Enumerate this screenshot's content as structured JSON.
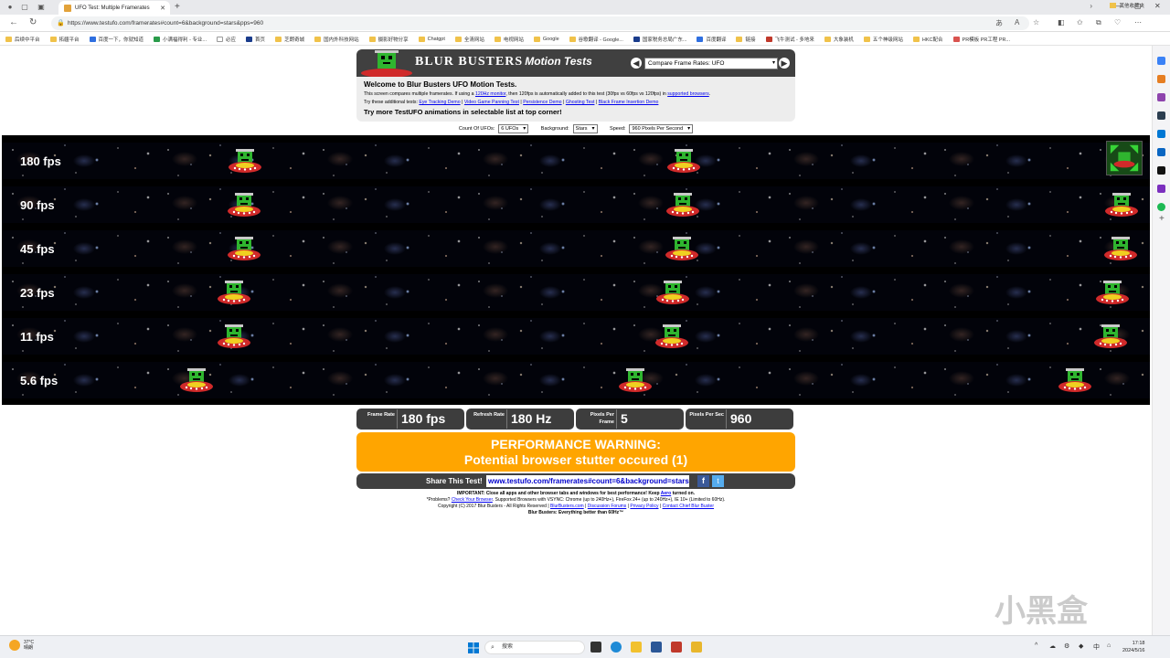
{
  "browser": {
    "tab_title": "UFO Test: Multiple Framerates",
    "url": "https://www.testufo.com/framerates#count=6&background=stars&pps=960",
    "bookmarks": [
      "后续中平台",
      "拓疆平台",
      "百度一下，你就知道",
      "小满福得利 - 专业...",
      "必应",
      "首页",
      "芝朗奇城",
      "国内外科技网站",
      "摄影好物分享",
      "Chatgpt",
      "全清网站",
      "电视网站",
      "Google",
      "谷歌翻译 - Google...",
      "国家税务总局广东...",
      "百度翻译",
      "链接",
      "飞牛测试 - 多地来",
      "大象装机",
      "五个神级网站",
      "HKC配合",
      "PR模板 PR工程 PR..."
    ],
    "other_bookmarks": "其他收藏夹"
  },
  "header": {
    "brand": "BLUR  BUSTERS",
    "brand_sub": "Motion Tests",
    "prev_arrow": "◀",
    "next_arrow": "▶",
    "test_selector": "Compare Frame Rates: UFO"
  },
  "welcome": {
    "title": "Welcome to Blur Busters UFO Motion Tests.",
    "line1_a": "This screen compares multiple framerates. If using a ",
    "line1_link1": "120Hz monitor",
    "line1_b": ", then 120fps is automatically added to this test (30fps vs 60fps vs 120fps) in ",
    "line1_link2": "supported browsers",
    "line1_c": ".",
    "line2_prefix": "Try these additional tests: ",
    "links": [
      "Eye Tracking Demo",
      "Video Game Panning Test",
      "Persistence Demo",
      "Ghosting Test",
      "Black Frame Insertion Demo"
    ],
    "cta": "Try more TestUFO animations in selectable list at top corner!"
  },
  "controls": {
    "count_label": "Count Of UFOs:",
    "count_value": "6 UFOs",
    "background_label": "Background:",
    "background_value": "Stars",
    "speed_label": "Speed:",
    "speed_value": "960 Pixels Per Second"
  },
  "lanes": [
    {
      "label": "180 fps"
    },
    {
      "label": "90 fps"
    },
    {
      "label": "45 fps"
    },
    {
      "label": "23 fps"
    },
    {
      "label": "11 fps"
    },
    {
      "label": "5.6 fps"
    }
  ],
  "stats": {
    "frame_rate_label": "Frame Rate",
    "frame_rate_value": "180 fps",
    "refresh_rate_label": "Refresh Rate",
    "refresh_rate_value": "180 Hz",
    "ppf_label": "Pixels Per Frame",
    "ppf_value": "5",
    "pps_label": "Pixels Per Sec",
    "pps_value": "960"
  },
  "warning": {
    "title": "PERFORMANCE WARNING:",
    "message": "Potential browser stutter occured (1)"
  },
  "share": {
    "label": "Share This Test!",
    "url": "www.testufo.com/framerates#count=6&background=stars",
    "fb": "f",
    "tw": "t"
  },
  "footer": {
    "important": "IMPORTANT: Close all apps and other browser tabs and windows for best performance! Keep ",
    "aero": "Aero",
    "important_end": " turned on.",
    "problems": "*Problems? ",
    "check_browser": "Check Your Browser",
    "supported": ". Supported Browsers with VSYNC: Chrome (up to 240Hz+), FireFox 24+ (up to 240Hz+), IE 10+ (Limited to 60Hz).",
    "copyright": "Copyright (C) 2017 Blur Busters - All Rights Reserved | ",
    "f_links": [
      "BlurBusters.com",
      "Discussion Forums",
      "Privacy Policy",
      "Contact Chief Blur Buster"
    ],
    "tagline": "Blur Busters: Everything better than 60Hz™"
  },
  "watermark": "小黑盒",
  "taskbar": {
    "weather_temp": "37°C",
    "weather_desc": "晴朗",
    "search_placeholder": "搜索",
    "time": "17:18",
    "date": "2024/5/16",
    "ime": "中"
  }
}
